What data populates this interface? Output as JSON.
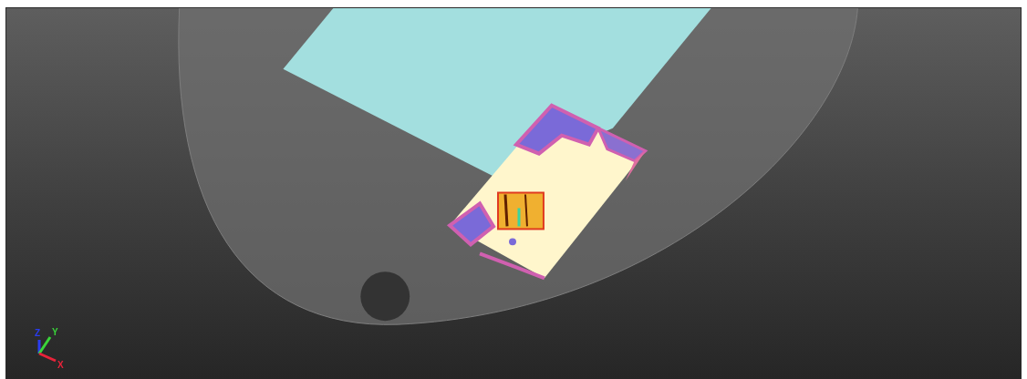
{
  "viewport": {
    "axes": [
      {
        "kind": "z",
        "label": "Z",
        "color": "#2a3cf0"
      },
      {
        "kind": "y",
        "label": "Y",
        "color": "#3ad43a"
      },
      {
        "kind": "x",
        "label": "X",
        "color": "#e8233a"
      }
    ]
  }
}
